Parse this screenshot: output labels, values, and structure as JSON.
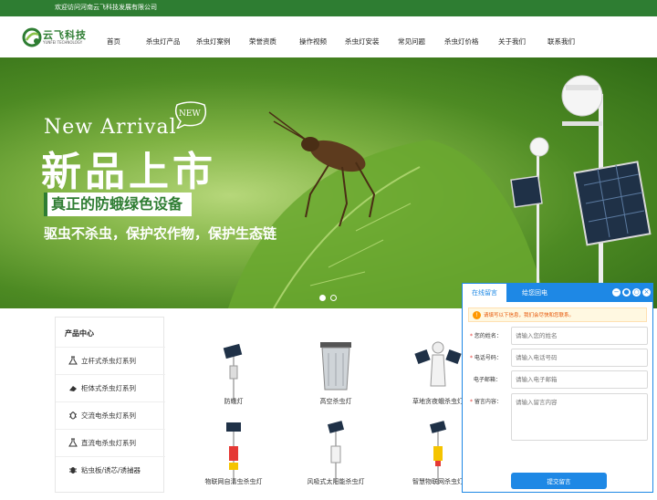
{
  "topbar": {
    "welcome": "欢迎访问河南云飞科技发展有限公司"
  },
  "logo": {
    "cn": "云飞科技",
    "en": "YUNFEI TECHNOLOGY"
  },
  "nav": {
    "items": [
      "首页",
      "杀虫灯产品",
      "杀虫灯案例",
      "荣誉资质",
      "操作视频",
      "杀虫灯安装",
      "常见问题",
      "杀虫灯价格",
      "关于我们",
      "联系我们"
    ]
  },
  "banner": {
    "badge": "NEW",
    "title_en": "New Arrival",
    "title_cn": "新品上市",
    "tagline": "真正的防蛾绿色设备",
    "subtitle": "驱虫不杀虫，保护农作物，保护生态链",
    "slides_total": 2,
    "slide_active": 1
  },
  "sidebar": {
    "title": "产品中心",
    "items": [
      "立杆式杀虫灯系列",
      "柜体式杀虫灯系列",
      "交流电杀虫灯系列",
      "直流电杀虫灯系列",
      "粘虫板/诱芯/诱捕器"
    ]
  },
  "products": [
    {
      "name": "防蛾灯"
    },
    {
      "name": "高空杀虫灯"
    },
    {
      "name": "草地贪夜蛾杀虫灯"
    },
    {
      "name": "物联网自清虫杀虫灯"
    },
    {
      "name": "风吸式太阳能杀虫灯"
    },
    {
      "name": "智慧物联网杀虫灯"
    }
  ],
  "chat": {
    "tabs": [
      "在线留言",
      "给您回电"
    ],
    "controls": [
      "−",
      "●",
      "○",
      "×"
    ],
    "notice": "请填写以下信息，我们会尽快和您联系。",
    "fields": [
      {
        "label": "您的姓名：",
        "placeholder": "请输入您的姓名",
        "required": true
      },
      {
        "label": "电话号码：",
        "placeholder": "请输入电话号码",
        "required": true
      },
      {
        "label": "电子邮箱：",
        "placeholder": "请输入电子邮箱",
        "required": false
      }
    ],
    "message": {
      "label": "留言内容：",
      "placeholder": "请输入留言内容",
      "required": true
    },
    "submit": "提交留言"
  },
  "colors": {
    "brand_green": "#2e7d32",
    "chat_blue": "#1e88e5"
  }
}
